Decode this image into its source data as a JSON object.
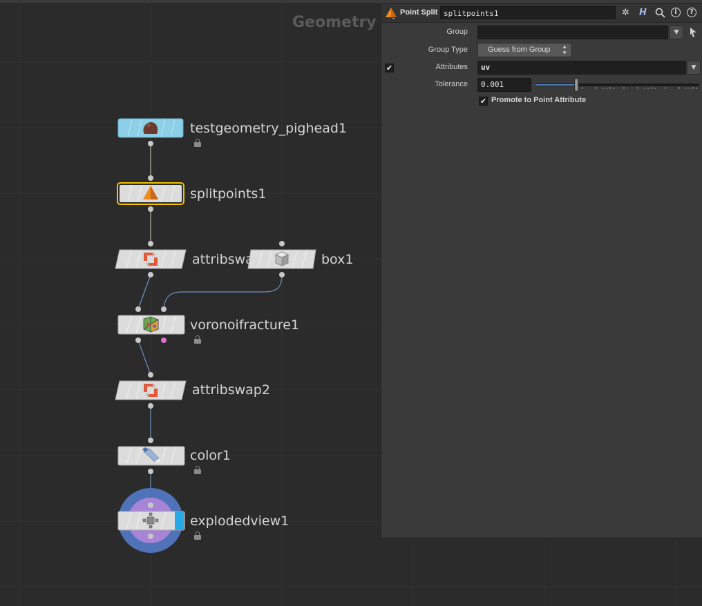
{
  "network": {
    "title": "Geometry",
    "nodes": [
      {
        "id": "testgeometry_pighead1",
        "label": "testgeometry_pighead1",
        "icon": "pighead-icon",
        "locked": true,
        "color": "#8ccfe6"
      },
      {
        "id": "splitpoints1",
        "label": "splitpoints1",
        "icon": "pyramid-icon",
        "selected": true,
        "color": "#dcdcdc"
      },
      {
        "id": "attribswap1",
        "label": "attribswa",
        "icon": "attribswap-icon",
        "color": "#dcdcdc"
      },
      {
        "id": "box1",
        "label": "box1",
        "icon": "box-icon",
        "color": "#dcdcdc"
      },
      {
        "id": "voronoifracture1",
        "label": "voronoifracture1",
        "icon": "voronoi-icon",
        "locked": true,
        "color": "#dcdcdc"
      },
      {
        "id": "attribswap2",
        "label": "attribswap2",
        "icon": "attribswap-icon",
        "color": "#dcdcdc"
      },
      {
        "id": "color1",
        "label": "color1",
        "icon": "paint-tube-icon",
        "locked": true,
        "color": "#dcdcdc"
      },
      {
        "id": "explodedview1",
        "label": "explodedview1",
        "icon": "explodedview-icon",
        "locked": true,
        "display_flag": true,
        "color": "#dcdcdc"
      }
    ]
  },
  "params": {
    "node_type": "Point Split",
    "node_name": "splitpoints1",
    "header_icons": [
      "gear-icon",
      "houdini-h-icon",
      "search-icon",
      "info-icon",
      "help-icon"
    ],
    "group": {
      "label": "Group",
      "value": ""
    },
    "group_type": {
      "label": "Group Type",
      "value": "Guess from Group"
    },
    "attributes": {
      "label": "Attributes",
      "value": "uv",
      "enabled": true
    },
    "tolerance": {
      "label": "Tolerance",
      "value": "0.001",
      "slider_fraction": 0.25
    },
    "promote": {
      "label": "Promote to Point Attribute",
      "checked": true
    }
  },
  "colors": {
    "background": "#2b2b2b",
    "panel": "#3a3a3a",
    "selection": "#f3c300",
    "wire": "#b7b7a0",
    "wire_blue": "#6f8fc4",
    "display_flag": "#27a9e8"
  }
}
